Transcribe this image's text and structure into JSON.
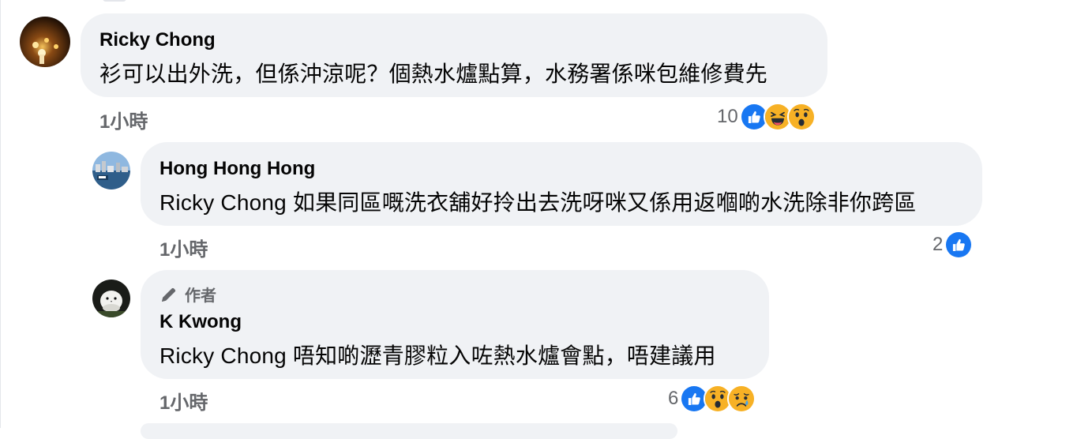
{
  "comments": [
    {
      "author": "Ricky Chong",
      "text": "衫可以出外洗，但係沖涼呢？個熱水爐點算，水務署係咪包維修費先",
      "time": "1小時",
      "reaction_count": "10",
      "reactions": [
        "like-icon",
        "haha-icon",
        "wow-icon"
      ]
    },
    {
      "author": "Hong Hong Hong",
      "text": "Ricky Chong 如果同區嘅洗衣舖好拎出去洗呀咪又係用返嗰啲水洗除非你跨區",
      "time": "1小時",
      "reaction_count": "2",
      "reactions": [
        "like-icon"
      ]
    },
    {
      "badge": "作者",
      "badge_icon": "pen-icon",
      "author": "K Kwong",
      "text": "Ricky Chong 唔知啲瀝青膠粒入咗熱水爐會點，唔建議用",
      "time": "1小時",
      "reaction_count": "6",
      "reactions": [
        "like-icon",
        "wow-icon",
        "sad-icon"
      ]
    }
  ],
  "colors": {
    "bubble": "#f0f2f5",
    "meta_text": "#65676b",
    "like_blue": "#1877f2",
    "emoji_yellow": "#f7b125"
  }
}
